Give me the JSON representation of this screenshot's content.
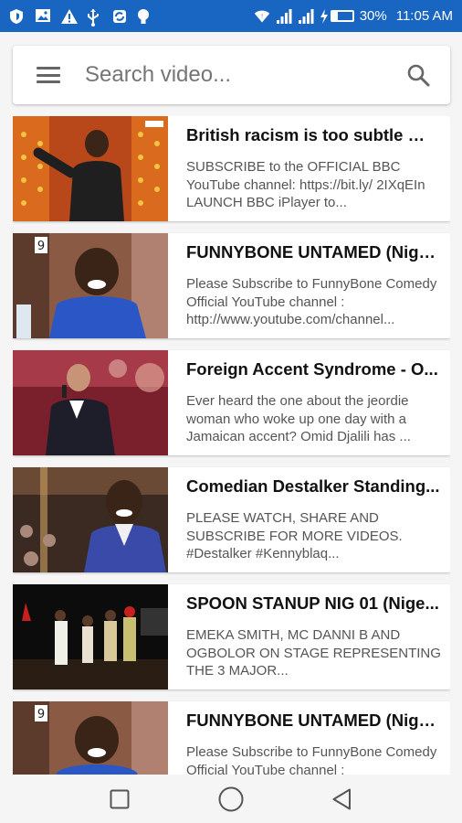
{
  "status_bar": {
    "battery_percent": "30%",
    "battery_level": 0.3,
    "time": "11:05 AM",
    "left_icons": [
      "shield-icon",
      "image-icon",
      "warning-icon",
      "usb-icon",
      "sync-icon",
      "bulb-icon"
    ],
    "right_icons": [
      "wifi-icon",
      "signal-icon",
      "signal-icon",
      "charging-icon"
    ]
  },
  "search": {
    "placeholder": "Search video...",
    "value": ""
  },
  "videos": [
    {
      "title": "British racism is too subtle 😂...",
      "description": "SUBSCRIBE to the OFFICIAL BBC YouTube channel: https://bit.ly/ 2IXqEIn LAUNCH BBC iPlayer to..."
    },
    {
      "title": "FUNNYBONE UNTAMED (Nige...",
      "description": "Please Subscribe to FunnyBone Comedy Official YouTube channel : http://www.youtube.com/channel..."
    },
    {
      "title": "Foreign Accent Syndrome - O...",
      "description": "Ever heard the one about the jeordie woman who woke up one day with a Jamaican accent? Omid Djalili has ..."
    },
    {
      "title": "Comedian Destalker Standing...",
      "description": "PLEASE WATCH, SHARE AND SUBSCRIBE FOR MORE VIDEOS. #Destalker #Kennyblaq..."
    },
    {
      "title": "SPOON STANUP NIG 01 (Nige...",
      "description": "EMEKA SMITH, MC DANNI B AND OGBOLOR ON STAGE REPRESENTING THE 3 MAJOR..."
    },
    {
      "title": "FUNNYBONE UNTAMED (Nige...",
      "description": "Please Subscribe to FunnyBone Comedy Official YouTube channel : http://www.youtube.com/channel..."
    }
  ],
  "colors": {
    "status_bar": "#1866c2",
    "background": "#f5f5f5"
  },
  "nav": {
    "icons": [
      "recents-icon",
      "home-icon",
      "back-icon"
    ]
  }
}
